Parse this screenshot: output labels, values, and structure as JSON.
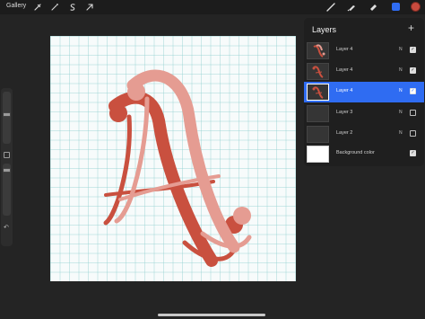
{
  "topbar": {
    "gallery_label": "Gallery",
    "left_tools": [
      "wrench-icon",
      "magic-wand-icon",
      "selection-icon",
      "transform-arrow-icon"
    ],
    "right_tools": [
      "brush-icon",
      "smudge-icon",
      "eraser-icon",
      "layers-icon",
      "color-icon"
    ],
    "current_color": "#c94b3e"
  },
  "sidebar": {
    "undo_label": "↶",
    "modifier_label": ""
  },
  "canvas": {
    "background": "#f7fbfb",
    "grid_color": "#96d2d2",
    "artwork": "script-letter-A",
    "colors": {
      "dark": "#c9503f",
      "light": "#e59c92"
    }
  },
  "layers_panel": {
    "title": "Layers",
    "add_label": "+",
    "layers": [
      {
        "name": "Layer 4",
        "blend": "N",
        "visible": true,
        "active": false,
        "thumb": "art"
      },
      {
        "name": "Layer 4",
        "blend": "N",
        "visible": true,
        "active": false,
        "thumb": "art"
      },
      {
        "name": "Layer 4",
        "blend": "N",
        "visible": true,
        "active": true,
        "thumb": "art"
      },
      {
        "name": "Layer 3",
        "blend": "N",
        "visible": false,
        "active": false,
        "thumb": "empty"
      },
      {
        "name": "Layer 2",
        "blend": "N",
        "visible": false,
        "active": false,
        "thumb": "empty"
      },
      {
        "name": "Background color",
        "blend": "",
        "visible": true,
        "active": false,
        "thumb": "white"
      }
    ],
    "check_mark": "✓"
  }
}
